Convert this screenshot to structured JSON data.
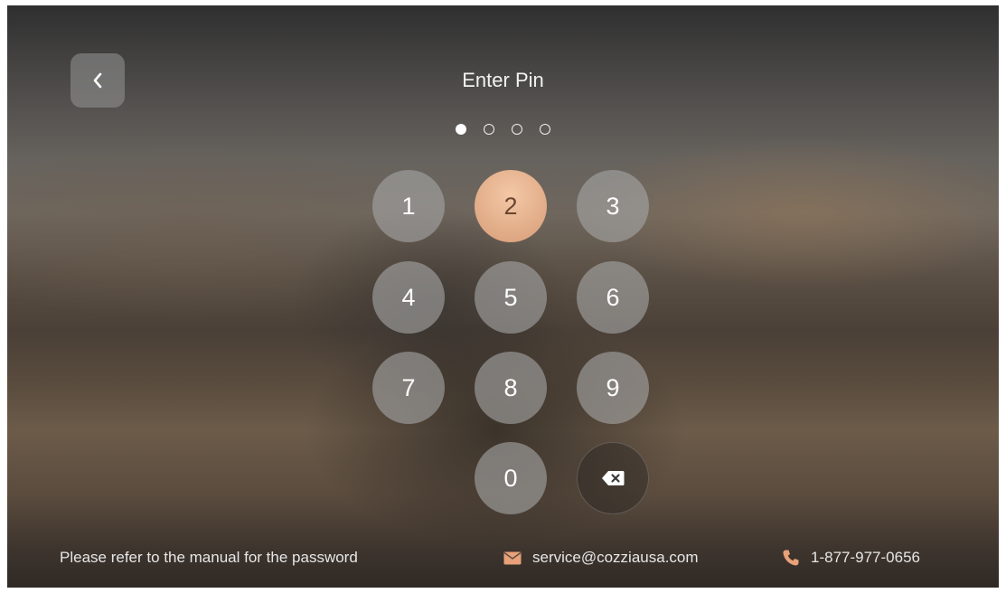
{
  "header": {
    "title": "Enter Pin",
    "back_icon": "chevron-left-icon"
  },
  "pin": {
    "length": 4,
    "entered": 1
  },
  "keypad": {
    "keys": [
      "1",
      "2",
      "3",
      "4",
      "5",
      "6",
      "7",
      "8",
      "9",
      "0"
    ],
    "active_key": "2",
    "backspace_icon": "backspace-icon"
  },
  "footer": {
    "hint": "Please refer to the manual for the password",
    "email": "service@cozziausa.com",
    "phone": "1-877-977-0656",
    "email_icon": "envelope-icon",
    "phone_icon": "phone-icon"
  },
  "colors": {
    "active_key": "#e3b08d",
    "key": "#a5a5a5",
    "contact_icon": "#e8a178"
  }
}
